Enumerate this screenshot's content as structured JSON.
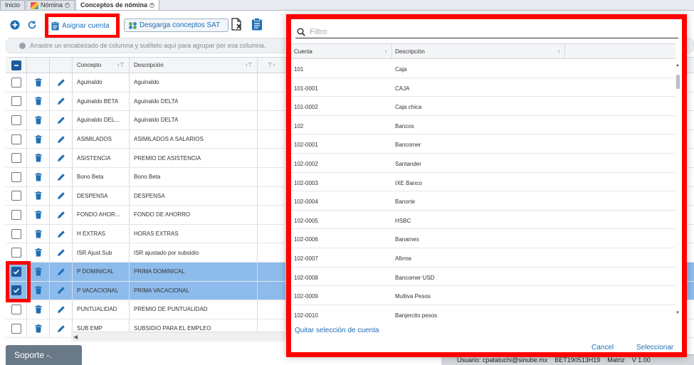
{
  "tabs": [
    {
      "label": "Inicio",
      "active": false,
      "closable": false
    },
    {
      "label": "Nómina",
      "active": false,
      "closable": true
    },
    {
      "label": "Conceptos de nómina",
      "active": true,
      "closable": true
    }
  ],
  "toolbar": {
    "assign_label": "Asignar cuenta",
    "sat_label": "Desgarga conceptos SAT"
  },
  "group_panel": {
    "text": "Arrastre un encabezado de columna y suéltelo aquí para agrupar por esa columna."
  },
  "grid": {
    "columns": [
      "Concepto",
      "Descripción"
    ],
    "rows": [
      {
        "concepto": "Aguinaldo",
        "descripcion": "Aguinaldo",
        "selected": false
      },
      {
        "concepto": "Aguinaldo BETA",
        "descripcion": "Aguinaldo DELTA",
        "selected": false
      },
      {
        "concepto": "Aguinaldo DEL...",
        "descripcion": "Aguinaldo DELTA",
        "selected": false
      },
      {
        "concepto": "ASIMILADOS",
        "descripcion": "ASIMILADOS A SALARIOS",
        "selected": false
      },
      {
        "concepto": "ASISTENCIA",
        "descripcion": "PREMIO DE ASISTENCIA",
        "selected": false
      },
      {
        "concepto": "Bono Beta",
        "descripcion": "Bono Beta",
        "selected": false
      },
      {
        "concepto": "DESPENSA",
        "descripcion": "DESPENSA",
        "selected": false
      },
      {
        "concepto": "FONDO AHOR...",
        "descripcion": "FONDO DE AHORRO",
        "selected": false
      },
      {
        "concepto": "H EXTRAS",
        "descripcion": "HORAS EXTRAS",
        "selected": false
      },
      {
        "concepto": "ISR Ajust.Sub",
        "descripcion": "ISR ajustado por subsidio",
        "selected": false
      },
      {
        "concepto": "P DOMINICAL",
        "descripcion": "PRIMA DOMINICAL",
        "selected": true
      },
      {
        "concepto": "P VACACIONAL",
        "descripcion": "PRIMA VACACIONAL",
        "selected": true
      },
      {
        "concepto": "PUNTUALIDAD",
        "descripcion": "PREMIO DE PUNTUALIDAD",
        "selected": false
      },
      {
        "concepto": "SUB EMP",
        "descripcion": "SUBSIDIO PARA EL EMPLEO",
        "selected": false
      }
    ]
  },
  "modal": {
    "filter_placeholder": "Filtro",
    "columns": [
      "Cuenta",
      "Descripción"
    ],
    "rows": [
      {
        "cuenta": "101",
        "descripcion": "Caja"
      },
      {
        "cuenta": "101-0001",
        "descripcion": "CAJA"
      },
      {
        "cuenta": "101-0002",
        "descripcion": "Caja chica"
      },
      {
        "cuenta": "102",
        "descripcion": "Bancos"
      },
      {
        "cuenta": "102-0001",
        "descripcion": "Bancomer"
      },
      {
        "cuenta": "102-0002",
        "descripcion": "Santander"
      },
      {
        "cuenta": "102-0003",
        "descripcion": "IXE Banco"
      },
      {
        "cuenta": "102-0004",
        "descripcion": "Banorte"
      },
      {
        "cuenta": "102-0005",
        "descripcion": "HSBC"
      },
      {
        "cuenta": "102-0006",
        "descripcion": "Banamex"
      },
      {
        "cuenta": "102-0007",
        "descripcion": "Afirme"
      },
      {
        "cuenta": "102-0008",
        "descripcion": "Bancomer USD"
      },
      {
        "cuenta": "102-0009",
        "descripcion": "Multiva Pesos"
      },
      {
        "cuenta": "102-0010",
        "descripcion": "Banjercito pesos"
      }
    ],
    "clear_label": "Quitar selección de cuenta",
    "cancel_label": "Cancel",
    "select_label": "Seleccionar"
  },
  "support": {
    "label": "Soporte -."
  },
  "status": {
    "user": "Usuario: cpatatuchi@sinube.mx",
    "rfc": "BET190513H19",
    "branch": "Matriz",
    "version": "V 1.00"
  },
  "colors": {
    "accent": "#1f6fb5",
    "selected_row": "#8dbbeb",
    "checkbox_on": "#1e5a9e",
    "highlight": "#ff0000"
  }
}
